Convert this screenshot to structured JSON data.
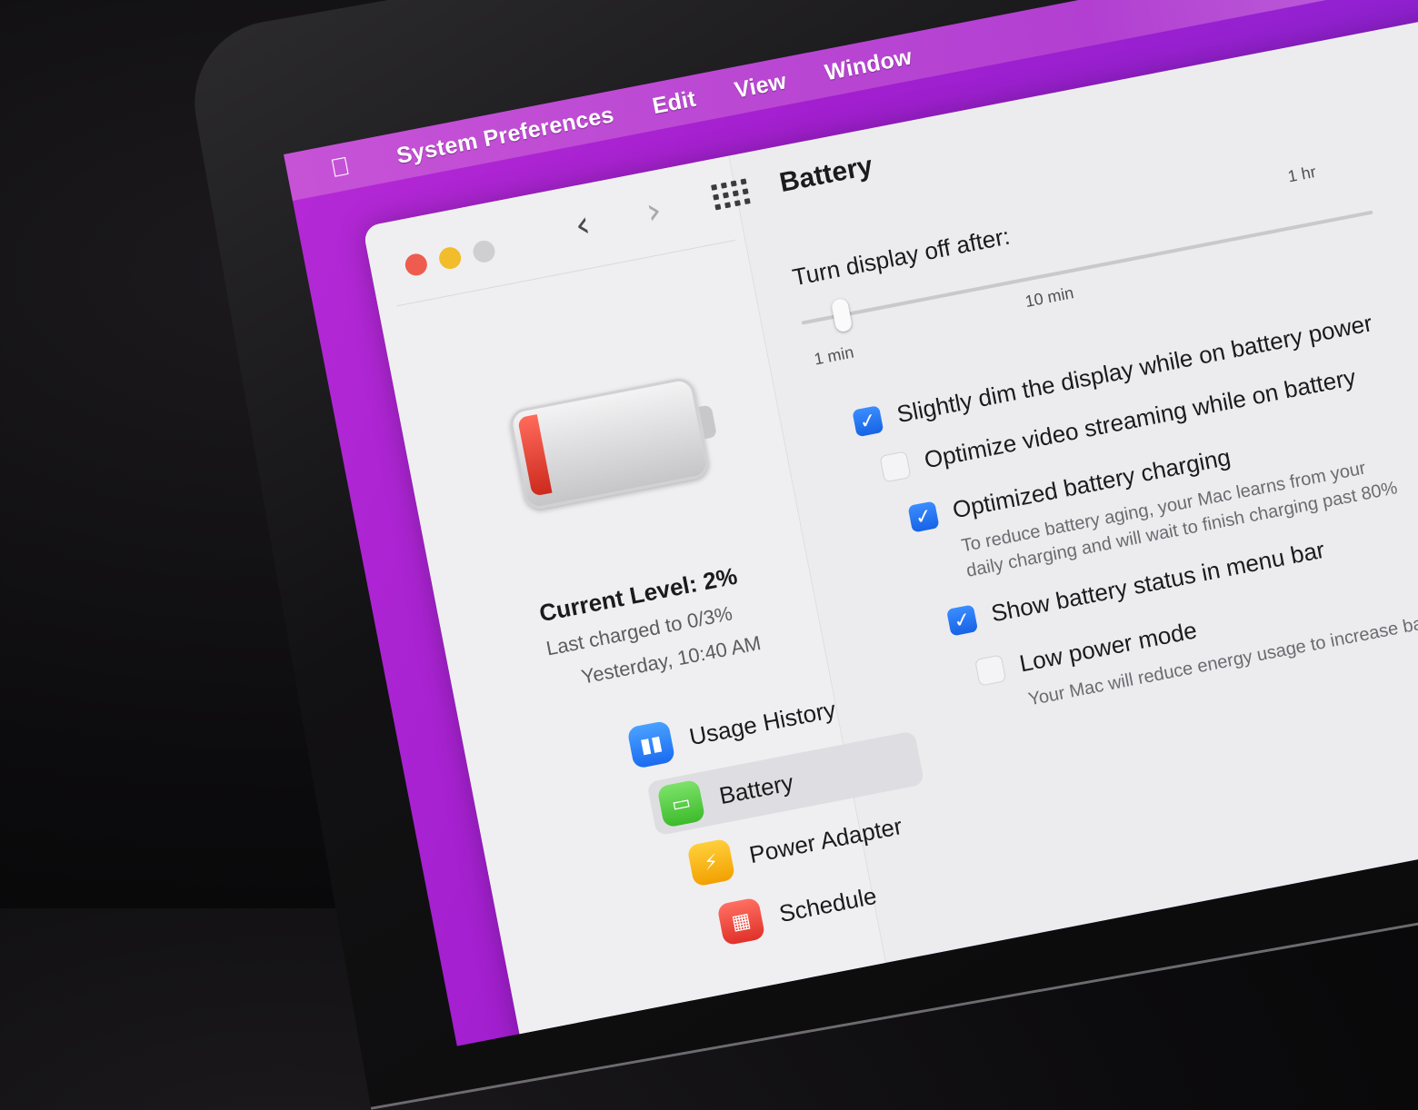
{
  "menubar": {
    "apple_icon": "apple-logo-icon",
    "items": [
      "System Preferences",
      "Edit",
      "View",
      "Window"
    ]
  },
  "toolbar": {
    "back_icon": "chevron-left-icon",
    "forward_icon": "chevron-right-icon",
    "grid_icon": "grid-icon",
    "title": "Battery"
  },
  "sidebar": {
    "battery_status": {
      "current_level": "Current Level: 2%",
      "last_charged": "Last charged to 0/3%",
      "time": "Yesterday, 10:40 AM"
    },
    "items": [
      {
        "label": "Usage History",
        "icon": "bar-chart-icon",
        "selected": false,
        "color": "#1a6bf0"
      },
      {
        "label": "Battery",
        "icon": "battery-icon",
        "selected": true,
        "color": "#3dbb2c"
      },
      {
        "label": "Power Adapter",
        "icon": "bolt-icon",
        "selected": false,
        "color": "#f2a100"
      },
      {
        "label": "Schedule",
        "icon": "calendar-icon",
        "selected": false,
        "color": "#e0312a"
      }
    ]
  },
  "main": {
    "display_off": {
      "label": "Turn display off after:",
      "min_label": "1 min",
      "mid_label": "10 min",
      "max_label": "1 hr",
      "value_minutes": 1
    },
    "options": [
      {
        "label": "Slightly dim the display while on battery power",
        "checked": true
      },
      {
        "label": "Optimize video streaming while on battery",
        "checked": false
      },
      {
        "label": "Optimized battery charging",
        "checked": true,
        "description_lines": [
          "To reduce battery aging, your Mac learns from your",
          "daily charging and will wait to finish charging past 80%"
        ]
      },
      {
        "label": "Show battery status in menu bar",
        "checked": true
      },
      {
        "label": "Low power mode",
        "checked": false,
        "description_lines": [
          "Your Mac will reduce energy usage to increase battery life."
        ]
      }
    ]
  }
}
